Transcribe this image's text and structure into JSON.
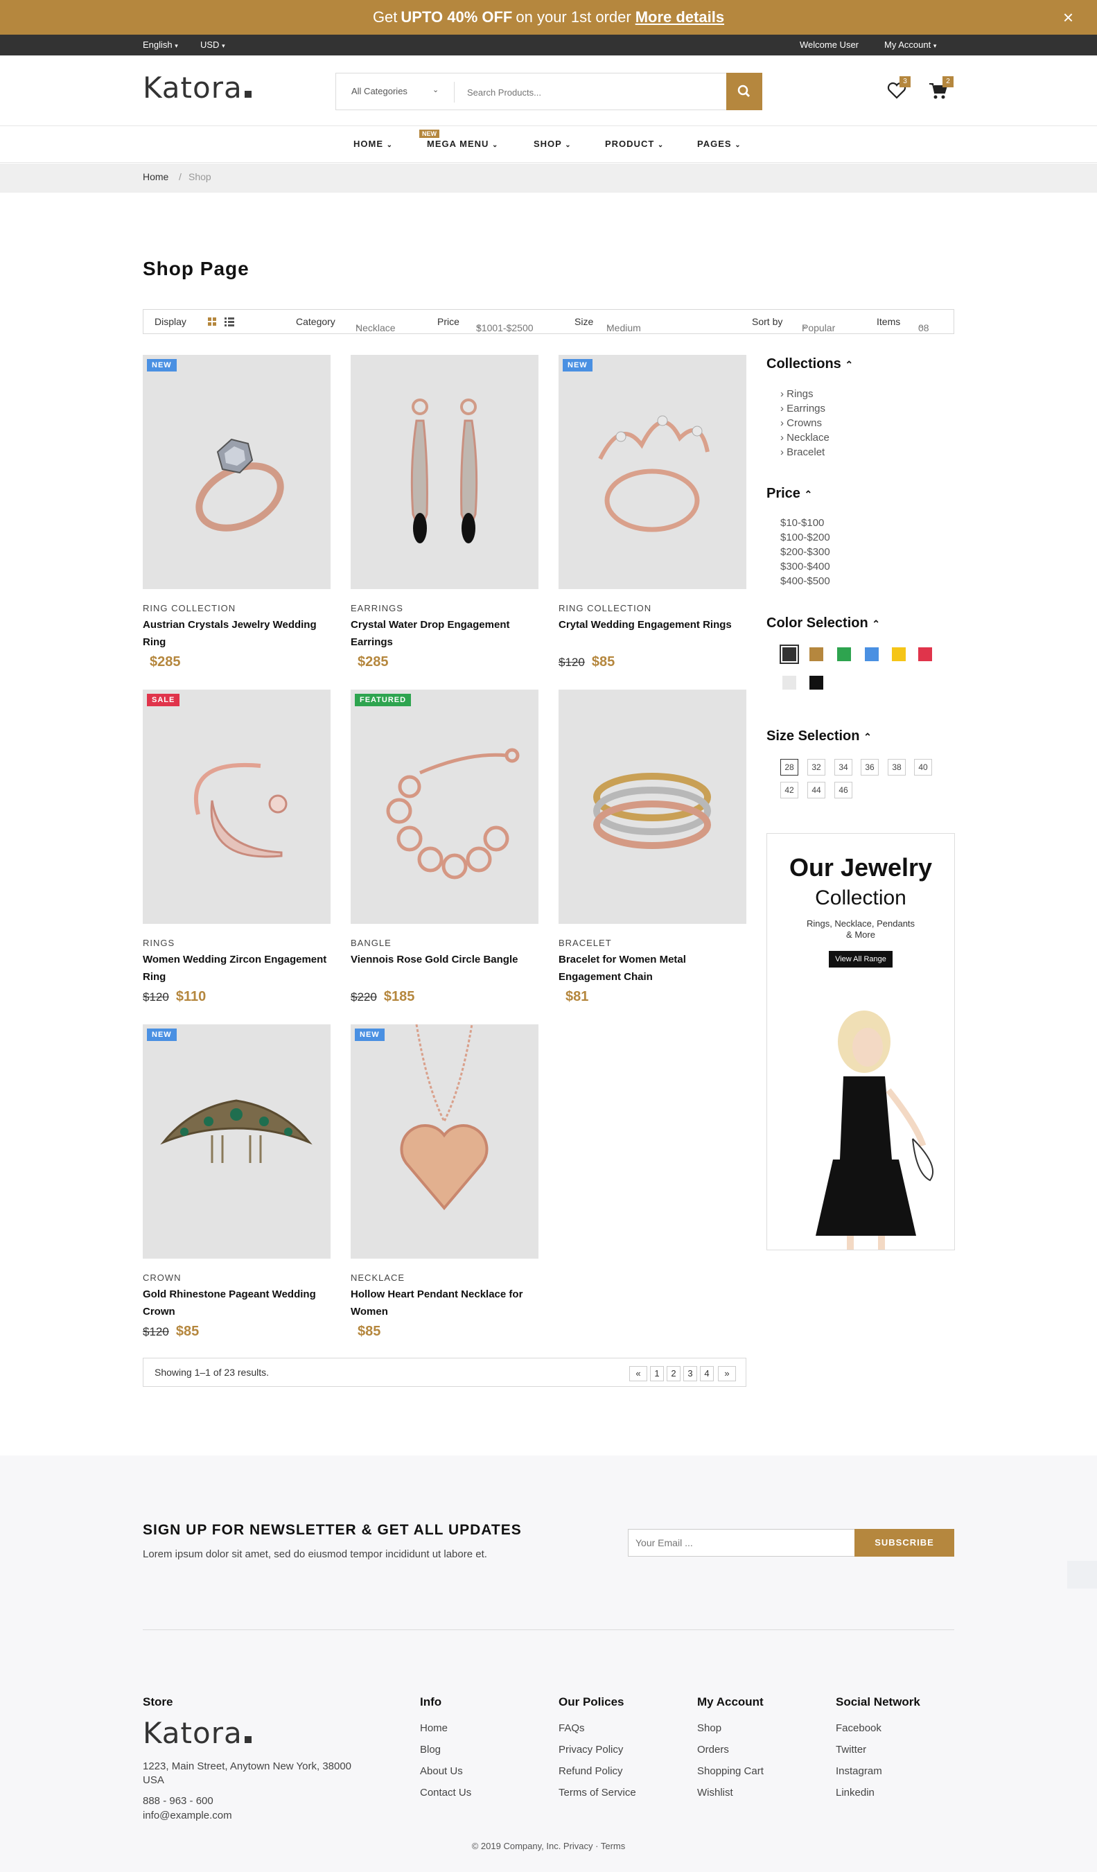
{
  "promo": {
    "pre": "Get",
    "bold": "UPTO 40% OFF",
    "post": "on your 1st order",
    "link": "More details",
    "close": "×"
  },
  "topbar": {
    "language": "English",
    "currency": "USD",
    "welcome": "Welcome User",
    "account": "My Account"
  },
  "header": {
    "logo": "Katora",
    "category": "All Categories",
    "search_placeholder": "Search Products...",
    "wishlist_count": "3",
    "cart_count": "2"
  },
  "nav": {
    "new_badge": "NEW",
    "items": [
      "HOME",
      "MEGA MENU",
      "SHOP",
      "PRODUCT",
      "PAGES"
    ]
  },
  "breadcrumb": {
    "home": "Home",
    "sep": "/",
    "current": "Shop"
  },
  "page_title": "Shop Page",
  "toolbar": {
    "display": "Display",
    "category_label": "Category",
    "category_value": "Necklace",
    "price_label": "Price",
    "price_value": "$1001-$2500",
    "size_label": "Size",
    "size_value": "Medium",
    "sort_label": "Sort by",
    "sort_value": "Popular",
    "items_label": "Items",
    "items_value": "08"
  },
  "products": [
    {
      "tag": "NEW",
      "tag_color": "#4a90e2",
      "category": "RING COLLECTION",
      "name": "Austrian Crystals Jewelry Wedding Ring",
      "old_price": "",
      "price": "$285",
      "icon": "diamond-ring"
    },
    {
      "tag": "",
      "tag_color": "",
      "category": "EARRINGS",
      "name": "Crystal Water Drop Engagement Earrings",
      "old_price": "",
      "price": "$285",
      "icon": "drop-earrings"
    },
    {
      "tag": "NEW",
      "tag_color": "#4a90e2",
      "category": "RING COLLECTION",
      "name": "Crytal Wedding Engagement Rings",
      "old_price": "$120",
      "price": "$85",
      "icon": "crown-ring"
    },
    {
      "tag": "SALE",
      "tag_color": "#e0344b",
      "category": "RINGS",
      "name": "Women Wedding Zircon Engagement Ring",
      "old_price": "$120",
      "price": "$110",
      "icon": "moon-ring"
    },
    {
      "tag": "FEATURED",
      "tag_color": "#2ea44f",
      "category": "BANGLE",
      "name": "Viennois Rose Gold Circle Bangle",
      "old_price": "$220",
      "price": "$185",
      "icon": "circle-bracelet"
    },
    {
      "tag": "",
      "tag_color": "",
      "category": "BRACELET",
      "name": "Bracelet for Women Metal Engagement Chain",
      "old_price": "",
      "price": "$81",
      "icon": "chain-bracelet"
    },
    {
      "tag": "NEW",
      "tag_color": "#4a90e2",
      "category": "CROWN",
      "name": "Gold Rhinestone Pageant Wedding Crown",
      "old_price": "$120",
      "price": "$85",
      "icon": "tiara"
    },
    {
      "tag": "NEW",
      "tag_color": "#4a90e2",
      "category": "NECKLACE",
      "name": "Hollow Heart Pendant Necklace for Women",
      "old_price": "",
      "price": "$85",
      "icon": "heart-pendant"
    }
  ],
  "sidebar": {
    "collections_title": "Collections",
    "collections": [
      "Rings",
      "Earrings",
      "Crowns",
      "Necklace",
      "Bracelet"
    ],
    "price_title": "Price",
    "prices": [
      "$10-$100",
      "$100-$200",
      "$200-$300",
      "$300-$400",
      "$400-$500"
    ],
    "color_title": "Color Selection",
    "colors": [
      "#333333",
      "#b5873e",
      "#2ea44f",
      "#4a90e2",
      "#f5c518",
      "#e0344b",
      "#e8e8e8",
      "#111111"
    ],
    "size_title": "Size Selection",
    "sizes": [
      "28",
      "32",
      "34",
      "36",
      "38",
      "40",
      "42",
      "44",
      "46"
    ]
  },
  "banner": {
    "title1": "Our Jewelry",
    "title2": "Collection",
    "sub1": "Rings, Necklace, Pendants",
    "sub2": "& More",
    "button": "View All Range"
  },
  "pagination": {
    "summary": "Showing 1–1 of 23 results.",
    "prev": "«",
    "pages": [
      "1",
      "2",
      "3",
      "4"
    ],
    "next": "»"
  },
  "newsletter": {
    "title": "SIGN UP FOR NEWSLETTER & GET ALL UPDATES",
    "text": "Lorem ipsum dolor sit amet, sed do eiusmod tempor incididunt ut labore et.",
    "placeholder": "Your Email ...",
    "button": "SUBSCRIBE"
  },
  "footer": {
    "store_title": "Store",
    "logo": "Katora",
    "address1": "1223, Main Street, Anytown New York, 38000",
    "address2": "USA",
    "phone": "888 - 963 - 600",
    "email": "info@example.com",
    "columns": [
      {
        "title": "Info",
        "links": [
          "Home",
          "Blog",
          "About Us",
          "Contact Us"
        ]
      },
      {
        "title": "Our Polices",
        "links": [
          "FAQs",
          "Privacy Policy",
          "Refund Policy",
          "Terms of Service"
        ]
      },
      {
        "title": "My Account",
        "links": [
          "Shop",
          "Orders",
          "Shopping Cart",
          "Wishlist"
        ]
      },
      {
        "title": "Social Network",
        "links": [
          "Facebook",
          "Twitter",
          "Instagram",
          "Linkedin"
        ]
      }
    ],
    "copyright": "© 2019 Company, Inc. Privacy · Terms"
  }
}
